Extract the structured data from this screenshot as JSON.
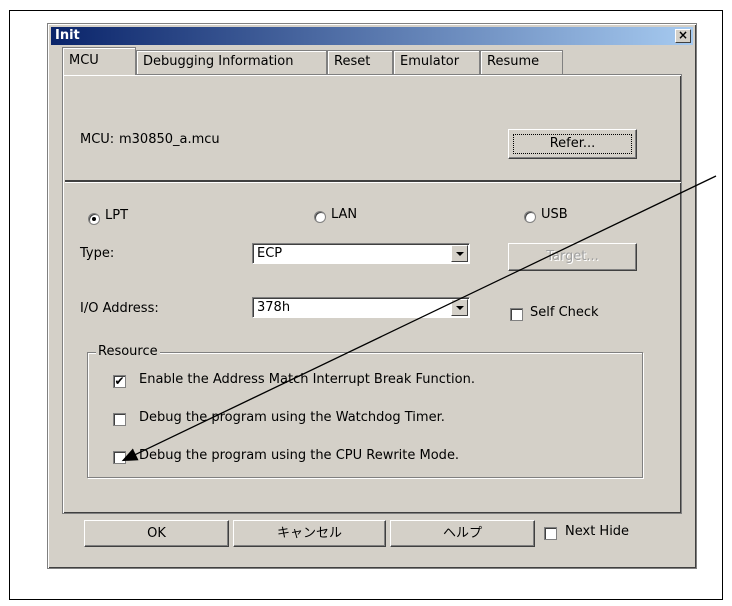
{
  "dialog": {
    "title": "Init",
    "close_label": "×"
  },
  "tabs": [
    "MCU",
    "Debugging Information",
    "Reset",
    "Emulator",
    "Resume"
  ],
  "mcu": {
    "label": "MCU:",
    "value": "m30850_a.mcu",
    "refer_button": "Refer..."
  },
  "connection": {
    "options": [
      "LPT",
      "LAN",
      "USB"
    ],
    "selected": "LPT",
    "type_label": "Type:",
    "type_value": "ECP",
    "address_label": "I/O Address:",
    "address_value": "378h",
    "target_button": "Target...",
    "self_check_label": "Self Check"
  },
  "resource": {
    "legend": "Resource",
    "items": [
      {
        "label": "Enable the Address Match Interrupt Break Function.",
        "checked": true
      },
      {
        "label": "Debug the program using the Watchdog Timer.",
        "checked": false
      },
      {
        "label": "Debug the program using the CPU Rewrite Mode.",
        "checked": false
      }
    ]
  },
  "footer": {
    "ok": "OK",
    "cancel": "キャンセル",
    "help": "ヘルプ",
    "next_hide": "Next Hide"
  }
}
